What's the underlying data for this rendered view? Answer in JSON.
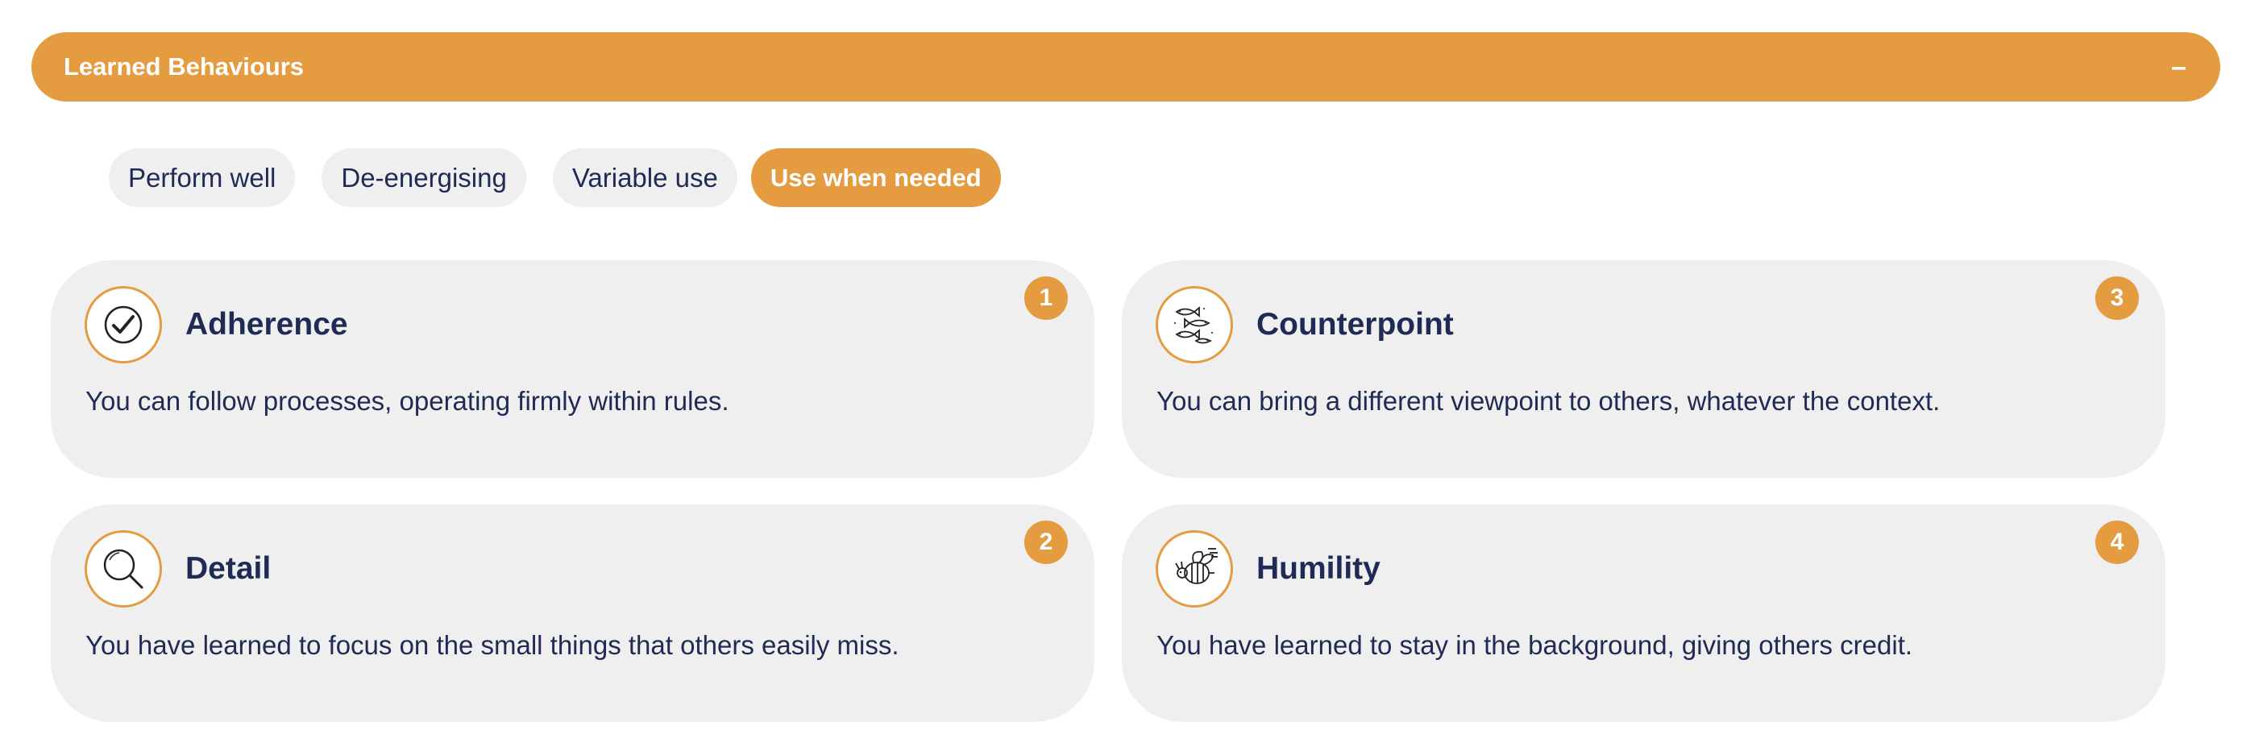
{
  "header": {
    "title": "Learned Behaviours",
    "collapse_label": "–"
  },
  "filters": [
    {
      "label": "Perform well",
      "active": false
    },
    {
      "label": "De-energising",
      "active": false
    },
    {
      "label": "Variable use",
      "active": false
    },
    {
      "label": "Use when needed",
      "active": true
    }
  ],
  "cards": [
    {
      "title": "Adherence",
      "description": "You can follow processes, operating firmly within rules.",
      "badge": "1",
      "icon": "checkmark-icon"
    },
    {
      "title": "Detail",
      "description": "You have learned to focus on the small things that others easily miss.",
      "badge": "2",
      "icon": "magnifier-icon"
    },
    {
      "title": "Counterpoint",
      "description": "You can bring a different viewpoint to others, whatever the context.",
      "badge": "3",
      "icon": "fish-school-icon"
    },
    {
      "title": "Humility",
      "description": "You have learned to stay in the background, giving others credit.",
      "badge": "4",
      "icon": "bee-icon"
    }
  ],
  "colors": {
    "accent": "#e59b3f",
    "text": "#1f2a55",
    "card_bg": "#efefef"
  }
}
